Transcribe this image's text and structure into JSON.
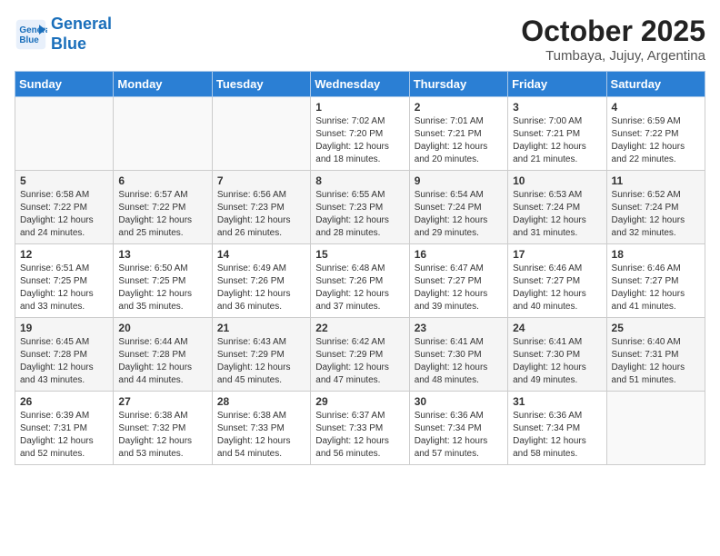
{
  "header": {
    "logo_line1": "General",
    "logo_line2": "Blue",
    "month_title": "October 2025",
    "location": "Tumbaya, Jujuy, Argentina"
  },
  "weekdays": [
    "Sunday",
    "Monday",
    "Tuesday",
    "Wednesday",
    "Thursday",
    "Friday",
    "Saturday"
  ],
  "weeks": [
    [
      {
        "day": "",
        "info": ""
      },
      {
        "day": "",
        "info": ""
      },
      {
        "day": "",
        "info": ""
      },
      {
        "day": "1",
        "info": "Sunrise: 7:02 AM\nSunset: 7:20 PM\nDaylight: 12 hours\nand 18 minutes."
      },
      {
        "day": "2",
        "info": "Sunrise: 7:01 AM\nSunset: 7:21 PM\nDaylight: 12 hours\nand 20 minutes."
      },
      {
        "day": "3",
        "info": "Sunrise: 7:00 AM\nSunset: 7:21 PM\nDaylight: 12 hours\nand 21 minutes."
      },
      {
        "day": "4",
        "info": "Sunrise: 6:59 AM\nSunset: 7:22 PM\nDaylight: 12 hours\nand 22 minutes."
      }
    ],
    [
      {
        "day": "5",
        "info": "Sunrise: 6:58 AM\nSunset: 7:22 PM\nDaylight: 12 hours\nand 24 minutes."
      },
      {
        "day": "6",
        "info": "Sunrise: 6:57 AM\nSunset: 7:22 PM\nDaylight: 12 hours\nand 25 minutes."
      },
      {
        "day": "7",
        "info": "Sunrise: 6:56 AM\nSunset: 7:23 PM\nDaylight: 12 hours\nand 26 minutes."
      },
      {
        "day": "8",
        "info": "Sunrise: 6:55 AM\nSunset: 7:23 PM\nDaylight: 12 hours\nand 28 minutes."
      },
      {
        "day": "9",
        "info": "Sunrise: 6:54 AM\nSunset: 7:24 PM\nDaylight: 12 hours\nand 29 minutes."
      },
      {
        "day": "10",
        "info": "Sunrise: 6:53 AM\nSunset: 7:24 PM\nDaylight: 12 hours\nand 31 minutes."
      },
      {
        "day": "11",
        "info": "Sunrise: 6:52 AM\nSunset: 7:24 PM\nDaylight: 12 hours\nand 32 minutes."
      }
    ],
    [
      {
        "day": "12",
        "info": "Sunrise: 6:51 AM\nSunset: 7:25 PM\nDaylight: 12 hours\nand 33 minutes."
      },
      {
        "day": "13",
        "info": "Sunrise: 6:50 AM\nSunset: 7:25 PM\nDaylight: 12 hours\nand 35 minutes."
      },
      {
        "day": "14",
        "info": "Sunrise: 6:49 AM\nSunset: 7:26 PM\nDaylight: 12 hours\nand 36 minutes."
      },
      {
        "day": "15",
        "info": "Sunrise: 6:48 AM\nSunset: 7:26 PM\nDaylight: 12 hours\nand 37 minutes."
      },
      {
        "day": "16",
        "info": "Sunrise: 6:47 AM\nSunset: 7:27 PM\nDaylight: 12 hours\nand 39 minutes."
      },
      {
        "day": "17",
        "info": "Sunrise: 6:46 AM\nSunset: 7:27 PM\nDaylight: 12 hours\nand 40 minutes."
      },
      {
        "day": "18",
        "info": "Sunrise: 6:46 AM\nSunset: 7:27 PM\nDaylight: 12 hours\nand 41 minutes."
      }
    ],
    [
      {
        "day": "19",
        "info": "Sunrise: 6:45 AM\nSunset: 7:28 PM\nDaylight: 12 hours\nand 43 minutes."
      },
      {
        "day": "20",
        "info": "Sunrise: 6:44 AM\nSunset: 7:28 PM\nDaylight: 12 hours\nand 44 minutes."
      },
      {
        "day": "21",
        "info": "Sunrise: 6:43 AM\nSunset: 7:29 PM\nDaylight: 12 hours\nand 45 minutes."
      },
      {
        "day": "22",
        "info": "Sunrise: 6:42 AM\nSunset: 7:29 PM\nDaylight: 12 hours\nand 47 minutes."
      },
      {
        "day": "23",
        "info": "Sunrise: 6:41 AM\nSunset: 7:30 PM\nDaylight: 12 hours\nand 48 minutes."
      },
      {
        "day": "24",
        "info": "Sunrise: 6:41 AM\nSunset: 7:30 PM\nDaylight: 12 hours\nand 49 minutes."
      },
      {
        "day": "25",
        "info": "Sunrise: 6:40 AM\nSunset: 7:31 PM\nDaylight: 12 hours\nand 51 minutes."
      }
    ],
    [
      {
        "day": "26",
        "info": "Sunrise: 6:39 AM\nSunset: 7:31 PM\nDaylight: 12 hours\nand 52 minutes."
      },
      {
        "day": "27",
        "info": "Sunrise: 6:38 AM\nSunset: 7:32 PM\nDaylight: 12 hours\nand 53 minutes."
      },
      {
        "day": "28",
        "info": "Sunrise: 6:38 AM\nSunset: 7:33 PM\nDaylight: 12 hours\nand 54 minutes."
      },
      {
        "day": "29",
        "info": "Sunrise: 6:37 AM\nSunset: 7:33 PM\nDaylight: 12 hours\nand 56 minutes."
      },
      {
        "day": "30",
        "info": "Sunrise: 6:36 AM\nSunset: 7:34 PM\nDaylight: 12 hours\nand 57 minutes."
      },
      {
        "day": "31",
        "info": "Sunrise: 6:36 AM\nSunset: 7:34 PM\nDaylight: 12 hours\nand 58 minutes."
      },
      {
        "day": "",
        "info": ""
      }
    ]
  ]
}
